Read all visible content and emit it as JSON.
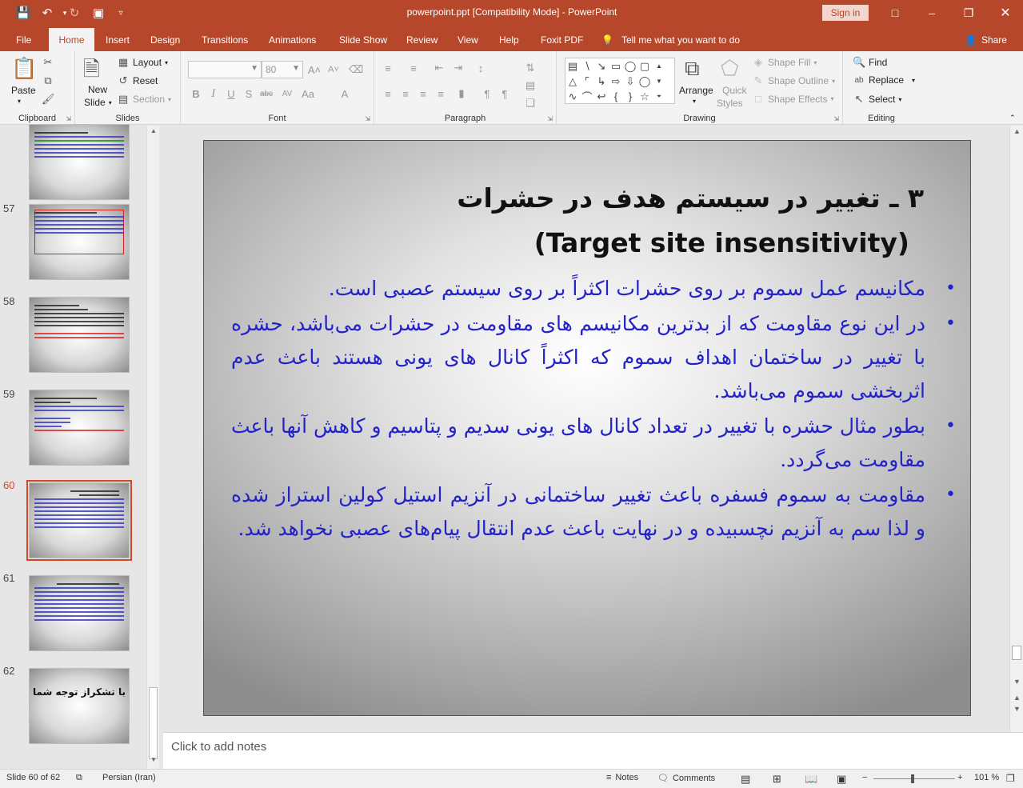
{
  "window": {
    "title": "powerpoint.ppt [Compatibility Mode]  -  PowerPoint",
    "sign_in": "Sign in"
  },
  "tabs": [
    "File",
    "Home",
    "Insert",
    "Design",
    "Transitions",
    "Animations",
    "Slide Show",
    "Review",
    "View",
    "Help",
    "Foxit PDF"
  ],
  "tell_me": "Tell me what you want to do",
  "share": "Share",
  "ribbon": {
    "clipboard": {
      "label": "Clipboard",
      "paste": "Paste"
    },
    "slides": {
      "label": "Slides",
      "new_slide_1": "New",
      "new_slide_2": "Slide",
      "layout": "Layout",
      "reset": "Reset",
      "section": "Section"
    },
    "font": {
      "label": "Font",
      "font_name": "",
      "font_size": "80"
    },
    "paragraph": {
      "label": "Paragraph"
    },
    "drawing": {
      "label": "Drawing",
      "arrange": "Arrange",
      "quick_styles_1": "Quick",
      "quick_styles_2": "Styles",
      "shape_fill": "Shape Fill",
      "shape_outline": "Shape Outline",
      "shape_effects": "Shape Effects"
    },
    "editing": {
      "label": "Editing",
      "find": "Find",
      "replace": "Replace",
      "select": "Select"
    }
  },
  "thumbnails": {
    "numbers": [
      "57",
      "58",
      "59",
      "60",
      "61",
      "62"
    ],
    "slide62_text": "با تشکراز توجه شما",
    "selected": "60"
  },
  "slide": {
    "title_fa": "۳ ـ تغییر در سیستم هدف در حشرات",
    "title_en": "(Target site insensitivity)",
    "bullets": [
      "مکانیسم عمل سموم بر روی حشرات اکثراً بر روی سیستم عصبی است.",
      " در این نوع مقاومت که از بدترین مکانیسم های مقاومت در حشرات می‌باشد، حشره با تغییر در ساختمان اهداف سموم که اکثراً کانال های یونی هستند باعث عدم اثربخشی سموم می‌باشد.",
      "بطور مثال حشره با تغییر در تعداد کانال های یونی سدیم و پتاسیم و کاهش آنها باعث مقاومت می‌گردد.",
      "مقاومت به سموم فسفره باعث تغییر ساختمانی در آنزیم استیل کولین استراز شده و لذا سم به آنزیم نچسبیده و در نهایت باعث عدم انتقال پیام‌های عصبی نخواهد شد."
    ],
    "bullet_color": "#2323c8"
  },
  "notes_placeholder": "Click to add notes",
  "statusbar": {
    "slide_info": "Slide 60 of 62",
    "language": "Persian (Iran)",
    "notes": "Notes",
    "comments": "Comments",
    "zoom_minus": "−",
    "zoom_plus": "+",
    "zoom": "101 %"
  },
  "colors": {
    "accent": "#b7472a",
    "selected_thumb": "#d24726"
  }
}
